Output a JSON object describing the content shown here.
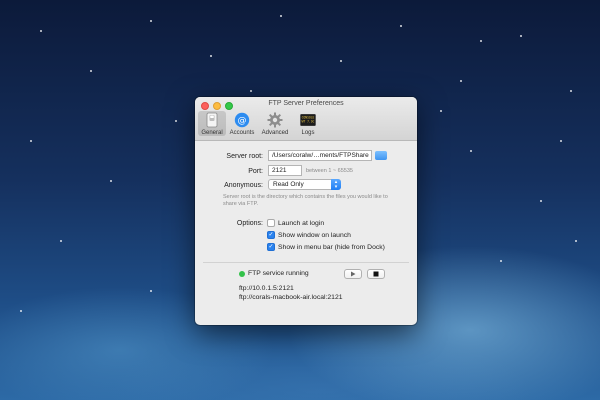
{
  "window": {
    "title": "FTP Server Preferences",
    "toolbar": [
      {
        "label": "General",
        "icon": "switch-icon"
      },
      {
        "label": "Accounts",
        "icon": "at-sign-icon"
      },
      {
        "label": "Advanced",
        "icon": "gear-icon"
      },
      {
        "label": "Logs",
        "icon": "console-icon"
      }
    ],
    "log_icon_text": [
      "CONSOLE",
      "WT 7.9c"
    ]
  },
  "general": {
    "server_root_label": "Server root:",
    "server_root_value": "/Users/coralw/…ments/FTPShare",
    "port_label": "Port:",
    "port_value": "2121",
    "port_hint": "between 1 ~ 65535",
    "anonymous_label": "Anonymous:",
    "anonymous_value": "Read Only",
    "description": "Server root is the directory which contains the files you would like to share via FTP.",
    "options_label": "Options:",
    "options": [
      {
        "label": "Launch at login",
        "checked": false
      },
      {
        "label": "Show window on launch",
        "checked": true
      },
      {
        "label": "Show in menu bar (hide from Dock)",
        "checked": true
      }
    ]
  },
  "status": {
    "text": "FTP service running",
    "color": "#33c24a",
    "urls": [
      "ftp://10.0.1.5:2121",
      "ftp://corals-macbook-air.local:2121"
    ]
  }
}
